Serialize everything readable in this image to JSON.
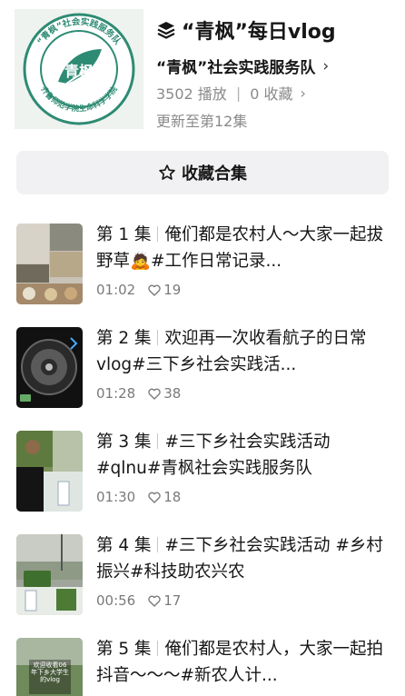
{
  "header": {
    "logo_text": "“青枫”社会实践服务队 齐鲁师范学院生命科学学院",
    "logo_center": "青枫",
    "title": "“青枫”每日vlog",
    "author": "“青枫”社会实践服务队",
    "plays": "3502 播放",
    "collects": "0 收藏",
    "update": "更新至第12集"
  },
  "collect_button": {
    "label": "收藏合集"
  },
  "episodes": [
    {
      "num": "第 1 集",
      "title": "俺们都是农村人～大家一起拔野草🙇#工作日常记录...",
      "duration": "01:02",
      "likes": "19"
    },
    {
      "num": "第 2 集",
      "title": "欢迎再一次收看航子的日常vlog#三下乡社会实践活...",
      "duration": "01:28",
      "likes": "38"
    },
    {
      "num": "第 3 集",
      "title": "#三下乡社会实践活动 #qlnu#青枫社会实践服务队",
      "duration": "01:30",
      "likes": "18"
    },
    {
      "num": "第 4 集",
      "title": "#三下乡社会实践活动 #乡村振兴#科技助农兴农",
      "duration": "00:56",
      "likes": "17"
    },
    {
      "num": "第 5 集",
      "title": "俺们都是农村人，大家一起拍抖音～～～#新农人计...",
      "duration": "",
      "likes": "",
      "thumb_text": "欢迎收看06年下乡大学生的vlog"
    }
  ],
  "colors": {
    "logo_green": "#2e8b73",
    "text_primary": "#161616",
    "text_secondary": "#8a8a8a",
    "button_bg": "#f1f1f3"
  }
}
